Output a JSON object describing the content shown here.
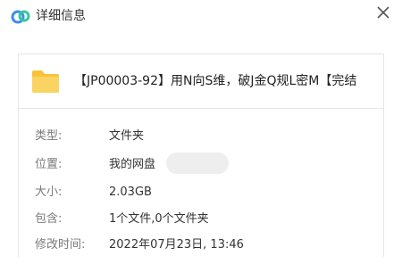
{
  "dialog": {
    "title": "详细信息",
    "close_icon": "close-icon",
    "logo_icon": "cloud-logo-icon"
  },
  "file": {
    "icon": "folder-icon",
    "name": "【JP00003-92】用N向S维，破J金Q规L密M【完结"
  },
  "info": {
    "type_label": "类型:",
    "type_value": "文件夹",
    "location_label": "位置:",
    "location_value": "我的网盘",
    "size_label": "大小:",
    "size_value": "2.03GB",
    "contains_label": "包含:",
    "contains_value": "1个文件,0个文件夹",
    "modified_label": "修改时间:",
    "modified_value": "2022年07月23日, 13:46"
  },
  "colors": {
    "logo_blue": "#3c8cf2",
    "logo_green": "#36c79d",
    "folder_yellow": "#f8c33b",
    "border": "#e3e6ea"
  }
}
